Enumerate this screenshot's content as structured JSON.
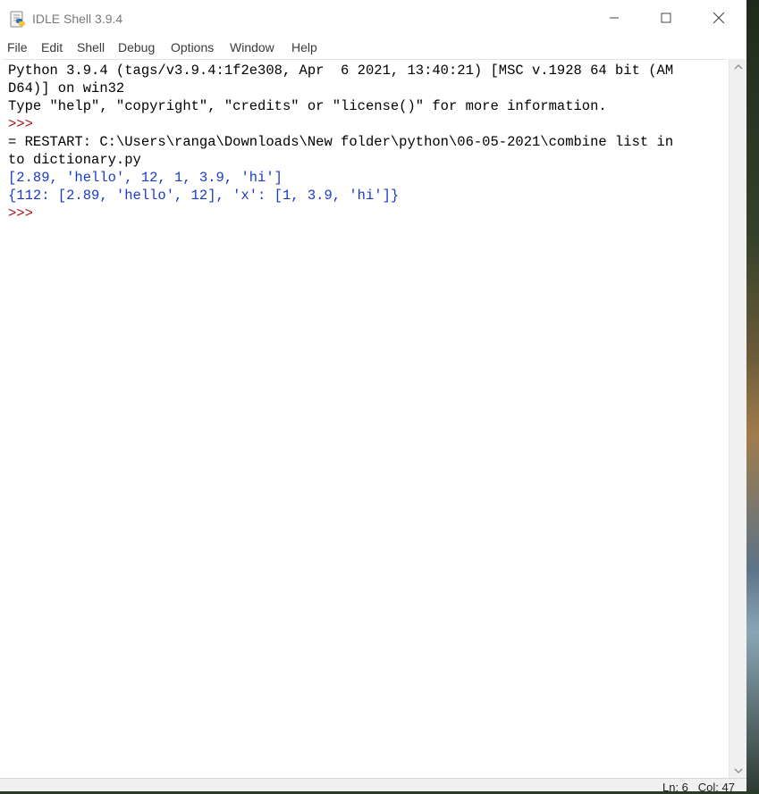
{
  "window": {
    "title": "IDLE Shell 3.9.4",
    "controls": {
      "minimize": "minimize",
      "maximize": "maximize",
      "close": "close"
    }
  },
  "menu": {
    "items": [
      "File",
      "Edit",
      "Shell",
      "Debug",
      "Options",
      "Window",
      "Help"
    ]
  },
  "shell": {
    "lines": [
      {
        "text": "Python 3.9.4 (tags/v3.9.4:1f2e308, Apr  6 2021, 13:40:21) [MSC v.1928 64 bit (AM",
        "kind": "normal"
      },
      {
        "text": "D64)] on win32",
        "kind": "normal"
      },
      {
        "text": "Type \"help\", \"copyright\", \"credits\" or \"license()\" for more information.",
        "kind": "normal"
      },
      {
        "text": ">>> ",
        "kind": "prompt"
      },
      {
        "text": "= RESTART: C:\\Users\\ranga\\Downloads\\New folder\\python\\06-05-2021\\combine list in",
        "kind": "normal"
      },
      {
        "text": "to dictionary.py",
        "kind": "normal"
      },
      {
        "text": "[2.89, 'hello', 12, 1, 3.9, 'hi']",
        "kind": "stdout"
      },
      {
        "text": "{112: [2.89, 'hello', 12], 'x': [1, 3.9, 'hi']}",
        "kind": "stdout"
      },
      {
        "text": ">>> ",
        "kind": "prompt"
      }
    ]
  },
  "status": {
    "position": "Ln: 6   Col: 47"
  },
  "colors": {
    "prompt": "#a4161a",
    "stdout": "#1a3acc",
    "text": "#000000"
  }
}
